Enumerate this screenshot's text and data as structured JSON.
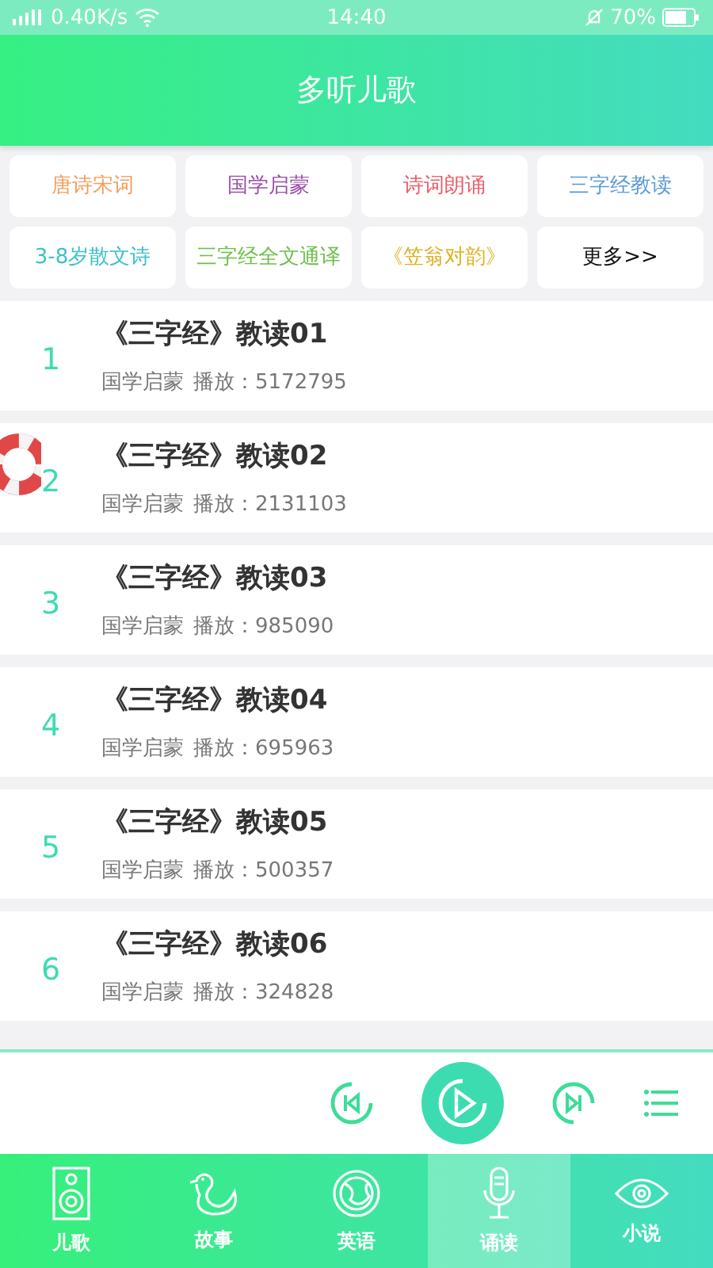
{
  "status_bar": {
    "speed": "0.40K/s",
    "time": "14:40",
    "battery": "70%"
  },
  "header": {
    "title": "多听儿歌"
  },
  "categories": [
    {
      "label": "唐诗宋词",
      "color": "#f0a060"
    },
    {
      "label": "国学启蒙",
      "color": "#9a4fa8"
    },
    {
      "label": "诗词朗诵",
      "color": "#e8606a"
    },
    {
      "label": "三字经教读",
      "color": "#5a9ad8"
    },
    {
      "label": "3-8岁散文诗",
      "color": "#3ec0c8"
    },
    {
      "label": "三字经全文通译",
      "color": "#6cc04a"
    },
    {
      "label": "《笠翁对韵》",
      "color": "#e0b020"
    },
    {
      "label": "更多>>",
      "color": "#111111"
    }
  ],
  "tracks": [
    {
      "number": "1",
      "title": "《三字经》教读01",
      "category": "国学启蒙",
      "plays": "播放：5172795"
    },
    {
      "number": "2",
      "title": "《三字经》教读02",
      "category": "国学启蒙",
      "plays": "播放：2131103"
    },
    {
      "number": "3",
      "title": "《三字经》教读03",
      "category": "国学启蒙",
      "plays": "播放：985090"
    },
    {
      "number": "4",
      "title": "《三字经》教读04",
      "category": "国学启蒙",
      "plays": "播放：695963"
    },
    {
      "number": "5",
      "title": "《三字经》教读05",
      "category": "国学启蒙",
      "plays": "播放：500357"
    },
    {
      "number": "6",
      "title": "《三字经》教读06",
      "category": "国学启蒙",
      "plays": "播放：324828"
    }
  ],
  "tabs": [
    {
      "label": "儿歌",
      "kind": "speaker",
      "selected": false
    },
    {
      "label": "故事",
      "kind": "duck",
      "selected": false
    },
    {
      "label": "英语",
      "kind": "globe",
      "selected": false
    },
    {
      "label": "诵读",
      "kind": "mic",
      "selected": true
    },
    {
      "label": "小说",
      "kind": "eye",
      "selected": false
    }
  ]
}
